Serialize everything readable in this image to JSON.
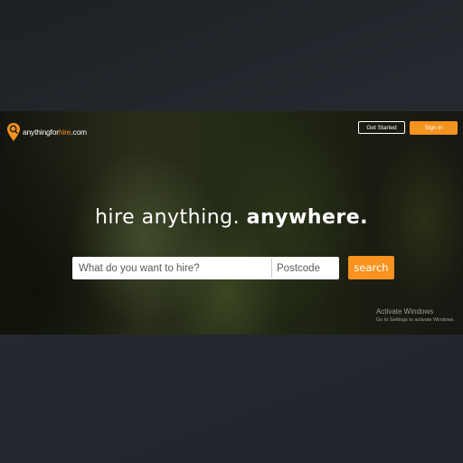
{
  "logo": {
    "text_main": "anythingfor",
    "text_accent": "hire",
    "text_suffix": ".com",
    "icon": "map-pin-search-icon"
  },
  "header": {
    "get_started_label": "Get Started",
    "sign_in_label": "Sign in"
  },
  "hero": {
    "headline_light": "hire anything.",
    "headline_bold": "anywhere."
  },
  "search": {
    "query_placeholder": "What do you want to hire?",
    "postcode_placeholder": "Postcode",
    "button_label": "search"
  },
  "watermark": {
    "title": "Activate Windows",
    "subtitle": "Go to Settings to activate Windows."
  },
  "colors": {
    "accent": "#f7931e",
    "text_light": "#ffffff"
  }
}
